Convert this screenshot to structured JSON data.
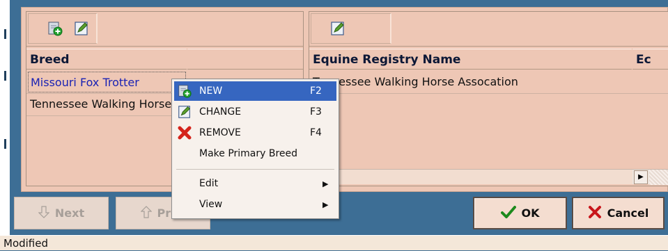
{
  "window": {
    "status_text": "Modified"
  },
  "breeds_grid": {
    "columns": [
      "Breed"
    ],
    "rows": [
      "Missouri Fox Trotter",
      "Tennessee Walking Horse"
    ],
    "toolbar_icons": [
      "new-record-icon",
      "edit-record-icon"
    ]
  },
  "registry_grid": {
    "columns": [
      "Equine Registry Name",
      "Ec"
    ],
    "rows": [
      "Tennessee Walking Horse Assocation"
    ],
    "toolbar_icons": [
      "edit-record-icon"
    ]
  },
  "buttons": {
    "next": "Next",
    "prev": "Prev",
    "ok": "OK",
    "cancel": "Cancel"
  },
  "context_menu": {
    "new": {
      "label": "NEW",
      "shortcut": "F2",
      "icon": "new-record-icon"
    },
    "change": {
      "label": "CHANGE",
      "shortcut": "F3",
      "icon": "edit-record-icon"
    },
    "remove": {
      "label": "REMOVE",
      "shortcut": "F4",
      "icon": "red-x-icon"
    },
    "make_primary": {
      "label": "Make Primary Breed"
    },
    "edit": {
      "label": "Edit"
    },
    "view": {
      "label": "View"
    }
  },
  "colors": {
    "panel": "#eec7b5",
    "background": "#3d6e95",
    "menu_highlight": "#3666c0",
    "link_text": "#1a22b4"
  }
}
